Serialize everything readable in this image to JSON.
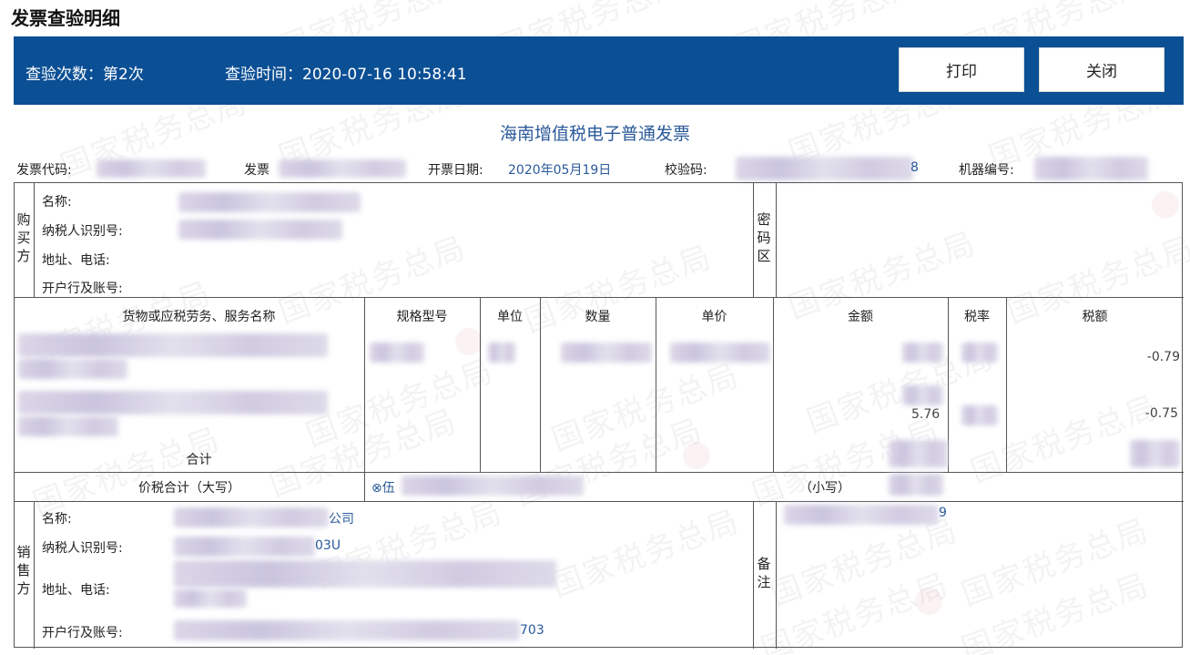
{
  "page": {
    "title": "发票查验明细"
  },
  "watermark": {
    "text": "国家税务总局"
  },
  "toolbar": {
    "check_count_label": "查验次数：第2次",
    "check_time_label": "查验时间：2020-07-16 10:58:41",
    "print_label": "打印",
    "close_label": "关闭",
    "bar_color": "#0b4f95"
  },
  "invoice": {
    "title": "海南增值税电子普通发票",
    "code_label": "发票代码:",
    "number_label": "发票",
    "date_label": "开票日期:",
    "date_value": "2020年05月19日",
    "check_code_label": "校验码:",
    "check_code_tail": "8",
    "machine_label": "机器编号:"
  },
  "buyer": {
    "section_label": "购买方",
    "name_label": "名称:",
    "taxid_label": "纳税人识别号:",
    "address_label": "地址、电话:",
    "bank_label": "开户行及账号:",
    "cipher_label": "密码区"
  },
  "items": {
    "headers": [
      "货物或应税劳务、服务名称",
      "规格型号",
      "单位",
      "数量",
      "单价",
      "金额",
      "税率",
      "税额"
    ],
    "rows": [
      {
        "tax": "-0.79"
      },
      {
        "amount_tail": "5.76",
        "tax": "-0.75"
      }
    ],
    "total_label": "合计"
  },
  "totals": {
    "upper_label": "价税合计（大写）",
    "upper_prefix": "⊗伍",
    "lower_label": "（小写）"
  },
  "seller": {
    "section_label": "销售方",
    "name_label": "名称:",
    "name_tail": "公司",
    "taxid_label": "纳税人识别号:",
    "taxid_tail": "03U",
    "address_label": "地址、电话:",
    "bank_label": "开户行及账号:",
    "bank_tail": "703",
    "remark_label": "备注",
    "remark_tail": "9"
  }
}
